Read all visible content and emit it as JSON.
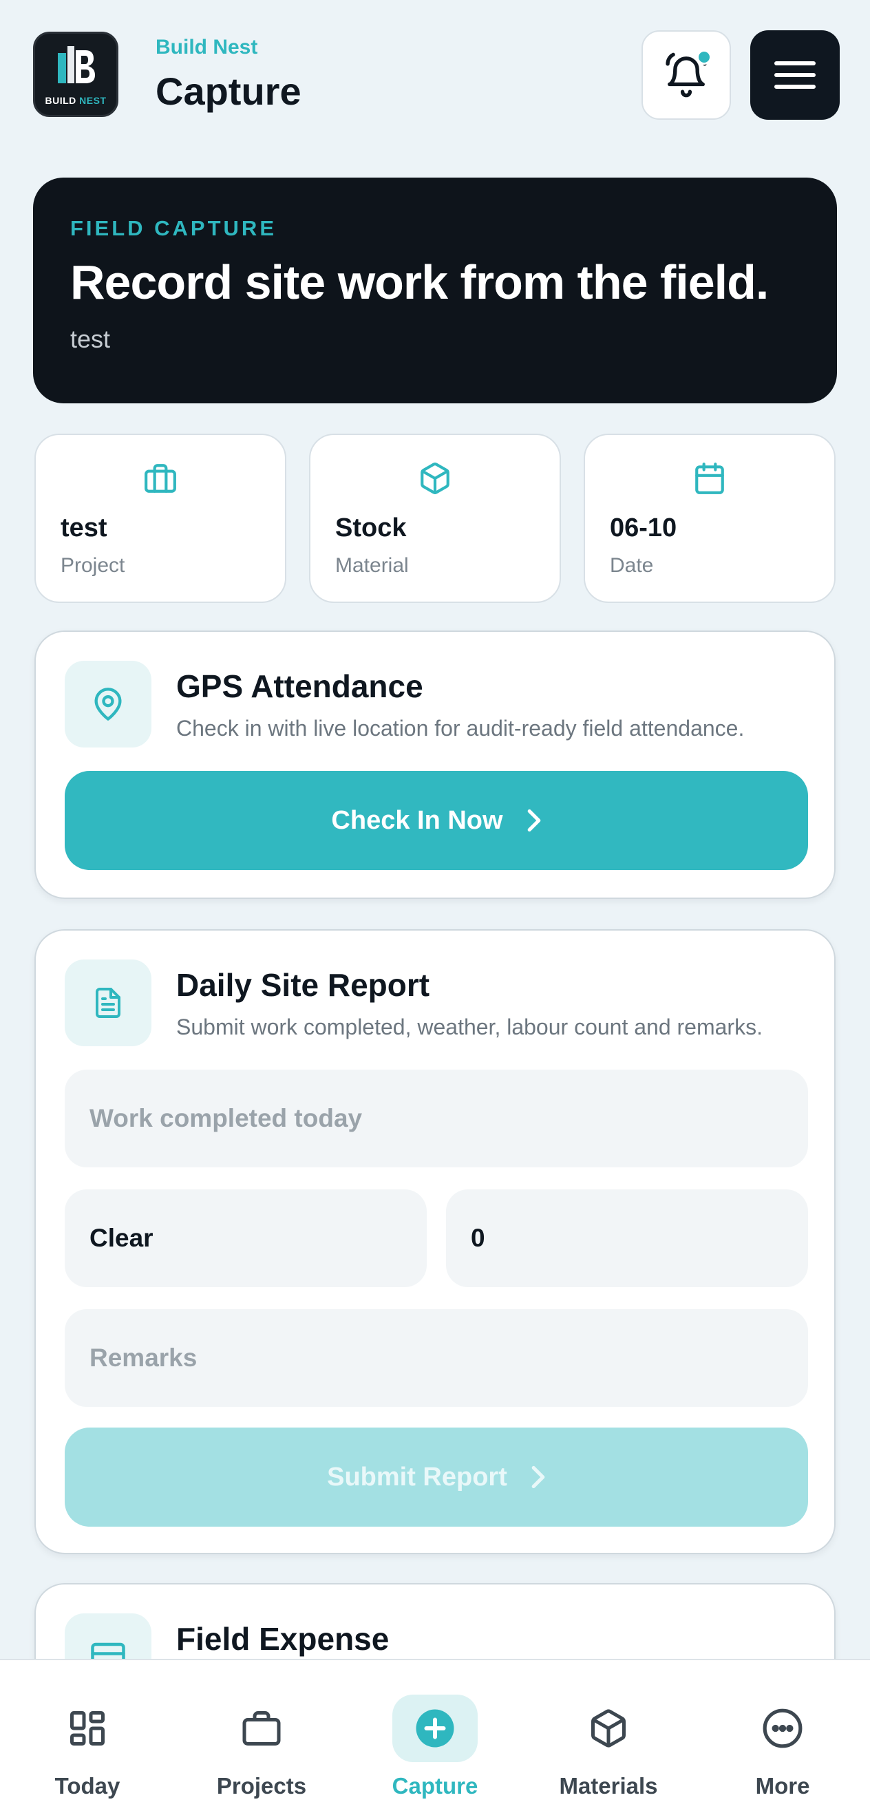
{
  "header": {
    "brand": "Build Nest",
    "title": "Capture",
    "logo_text_left": "BUILD",
    "logo_text_right": "NEST",
    "notification_icon": "bell-icon",
    "menu_icon": "hamburger-menu-icon"
  },
  "hero": {
    "eyebrow": "FIELD CAPTURE",
    "title": "Record site work from the field.",
    "subtitle": "test"
  },
  "stats": [
    {
      "icon": "briefcase-icon",
      "value": "test",
      "label": "Project"
    },
    {
      "icon": "cube-icon",
      "value": "Stock",
      "label": "Material"
    },
    {
      "icon": "calendar-icon",
      "value": "06-10",
      "label": "Date"
    }
  ],
  "gps_card": {
    "icon": "map-pin-icon",
    "title": "GPS Attendance",
    "description": "Check in with live location for audit-ready field attendance.",
    "button_label": "Check In Now"
  },
  "report_card": {
    "icon": "document-icon",
    "title": "Daily Site Report",
    "description": "Submit work completed, weather, labour count and remarks.",
    "work_placeholder": "Work completed today",
    "weather_value": "Clear",
    "labour_value": "0",
    "remarks_placeholder": "Remarks",
    "submit_label": "Submit Report"
  },
  "expense_card": {
    "icon": "card-icon",
    "title": "Field Expense"
  },
  "nav": [
    {
      "icon": "dashboard-icon",
      "label": "Today",
      "active": false
    },
    {
      "icon": "briefcase-icon",
      "label": "Projects",
      "active": false
    },
    {
      "icon": "plus-circle-icon",
      "label": "Capture",
      "active": true
    },
    {
      "icon": "cube-icon",
      "label": "Materials",
      "active": false
    },
    {
      "icon": "more-icon",
      "label": "More",
      "active": false
    }
  ],
  "colors": {
    "accent": "#2fb7bf",
    "dark": "#0e141b",
    "background": "#ecf3f7"
  }
}
